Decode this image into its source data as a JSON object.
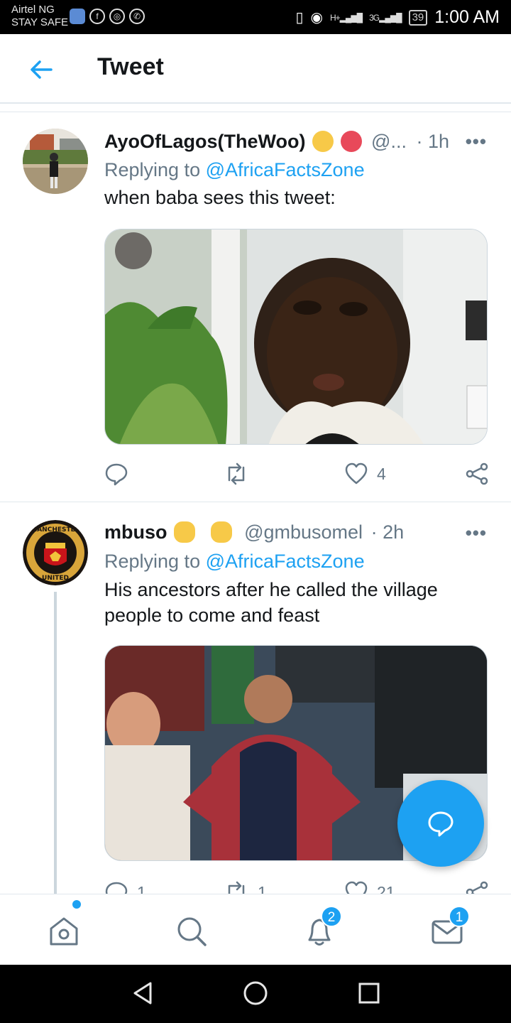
{
  "status_bar": {
    "carrier_line1": "Airtel NG",
    "carrier_line2": "STAY SAFE",
    "signal_1": "H+",
    "signal_2": "3G",
    "battery": "39",
    "time": "1:00 AM"
  },
  "header": {
    "title": "Tweet",
    "back_icon": "arrow-left-icon",
    "accent_color": "#1da1f2"
  },
  "tweets": [
    {
      "name": "AyoOfLagos(TheWoo)",
      "handle": "@...",
      "separator": "·",
      "time": "1h",
      "more": "•••",
      "replying_prefix": "Replying to",
      "replying_to": "@AfricaFactsZone",
      "text": "when baba sees this tweet:",
      "reply_count": "",
      "retweet_count": "",
      "like_count": "4"
    },
    {
      "name": "mbuso",
      "handle": "@gmbusomel",
      "separator": "·",
      "time": "2h",
      "more": "•••",
      "replying_prefix": "Replying to",
      "replying_to": "@AfricaFactsZone",
      "text": "His ancestors after he called the village people to come and feast",
      "reply_count": "1",
      "retweet_count": "1",
      "like_count": "21"
    }
  ],
  "bottom_nav": {
    "items": [
      "home-icon",
      "search-icon",
      "notifications-icon",
      "messages-icon"
    ],
    "notifications_badge": "2",
    "messages_badge": "1"
  },
  "compose_fab_icon": "compose-reply-icon"
}
